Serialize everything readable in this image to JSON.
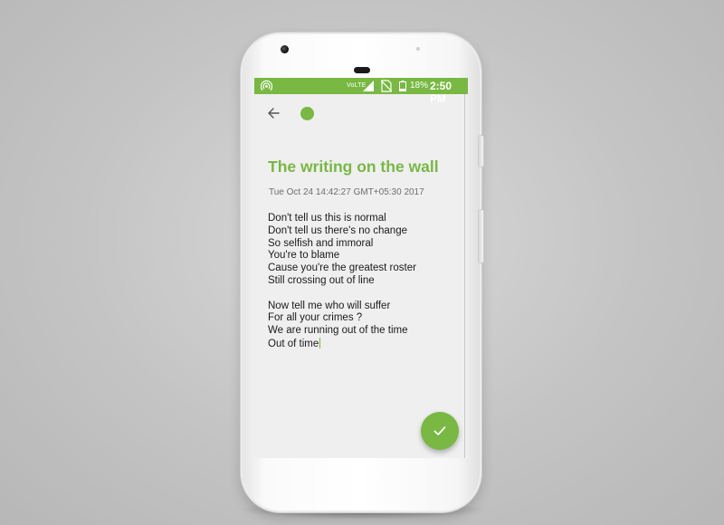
{
  "status_bar": {
    "network_label": "VoLTE",
    "battery_percent": "18%",
    "time": "2:50 PM",
    "icons": [
      "hotspot-icon",
      "signal-icon",
      "no-sim-icon",
      "battery-icon"
    ]
  },
  "toolbar": {
    "back_icon": "arrow-left-icon",
    "note_color": "#78b843"
  },
  "note": {
    "title": "The writing on the wall",
    "date": "Tue Oct 24 14:42:27 GMT+05:30 2017",
    "lines": [
      "Don't tell us this is normal",
      "Don't tell us there's no change",
      "So selfish and immoral",
      "You're to blame",
      "Cause you're the greatest roster",
      "Still crossing out of line",
      "",
      "Now tell me who will suffer",
      "For all your crimes ?",
      "We are running out of the time",
      "Out of time"
    ]
  },
  "fab": {
    "icon": "checkmark-icon"
  },
  "theme": {
    "accent": "#78b843",
    "screen_bg": "#efefef",
    "text": "#1a1a1a"
  }
}
